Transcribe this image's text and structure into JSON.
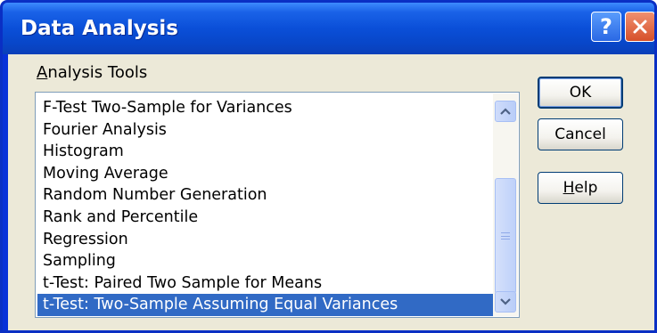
{
  "window": {
    "title": "Data Analysis",
    "help_glyph": "?"
  },
  "analysis_tools": {
    "label_first": "A",
    "label_rest": "nalysis Tools",
    "items": [
      {
        "label": "F-Test Two-Sample for Variances",
        "selected": false
      },
      {
        "label": "Fourier Analysis",
        "selected": false
      },
      {
        "label": "Histogram",
        "selected": false
      },
      {
        "label": "Moving Average",
        "selected": false
      },
      {
        "label": "Random Number Generation",
        "selected": false
      },
      {
        "label": "Rank and Percentile",
        "selected": false
      },
      {
        "label": "Regression",
        "selected": false
      },
      {
        "label": "Sampling",
        "selected": false
      },
      {
        "label": "t-Test: Paired Two Sample for Means",
        "selected": false
      },
      {
        "label": "t-Test: Two-Sample Assuming Equal Variances",
        "selected": true
      }
    ],
    "selected_color": "#316ac5"
  },
  "buttons": {
    "ok": "OK",
    "cancel": "Cancel",
    "help_first": "H",
    "help_rest": "elp"
  },
  "colors": {
    "titlebar": "#0a4fd8",
    "close": "#d6502a",
    "client": "#ece9d8"
  }
}
